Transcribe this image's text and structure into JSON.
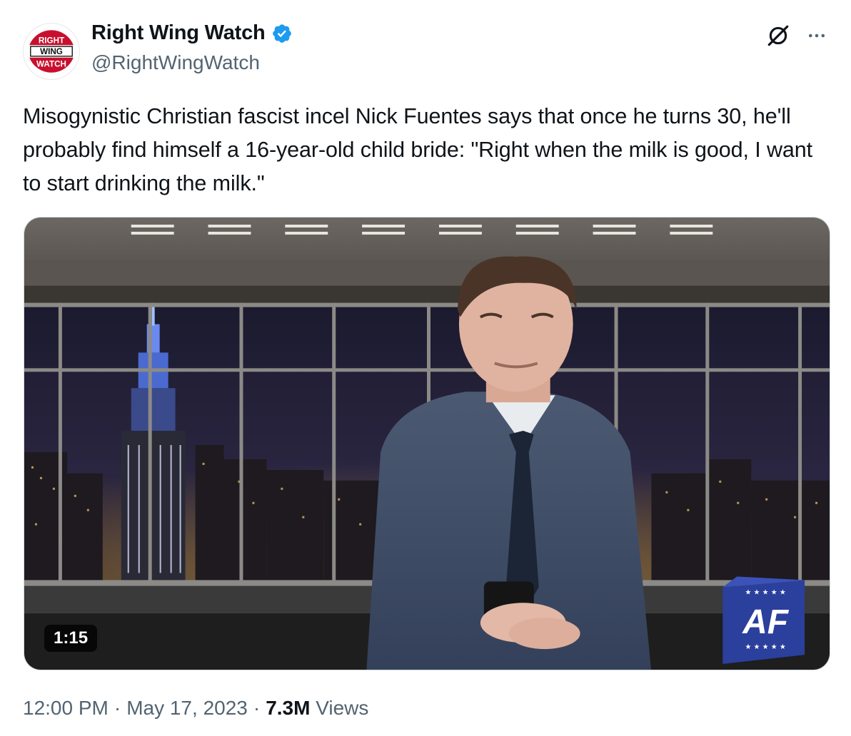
{
  "author": {
    "display_name": "Right Wing Watch",
    "handle": "@RightWingWatch",
    "verified": true,
    "avatar_logo_text": [
      "RIGHT",
      "WING",
      "WATCH"
    ]
  },
  "icons": {
    "verified": "verified-badge-icon",
    "grok": "grok-icon",
    "more": "more-options-icon"
  },
  "colors": {
    "verified_blue": "#1d9bf0",
    "logo_red": "#c8102e",
    "secondary_text": "#536471"
  },
  "tweet": {
    "text": "Misogynistic Christian fascist incel Nick Fuentes says that once he turns 30, he'll probably find himself a 16-year-old child bride: \"Right when the milk is good, I want to start drinking the milk.\""
  },
  "media": {
    "type": "video",
    "duration": "1:15",
    "watermark": "AF"
  },
  "meta": {
    "time": "12:00 PM",
    "separator": "·",
    "date": "May 17, 2023",
    "views_count": "7.3M",
    "views_label": "Views"
  }
}
